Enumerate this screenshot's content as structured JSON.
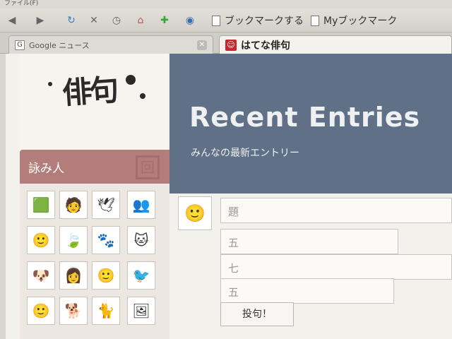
{
  "menubar": {
    "text": "ファイル(F)"
  },
  "toolbar": {
    "bookmark1": "ブックマークする",
    "bookmark2": "Myブックマーク"
  },
  "tabs": [
    {
      "label": "Google ニュース",
      "favicon": "G"
    },
    {
      "label": "はてな俳句",
      "favicon": "☺"
    }
  ],
  "logo": {
    "text": "俳句"
  },
  "sidebar": {
    "title": "詠み人",
    "avatars": [
      "🟩",
      "🧑",
      "🕊",
      "👥",
      "🙂",
      "🍃",
      "🐾",
      "🐱",
      "🐶",
      "👩",
      "🙂",
      "🐦",
      "🙂",
      "🐕",
      "🐈",
      "🖼"
    ]
  },
  "banner": {
    "title": "Recent Entries",
    "subtitle": "みんなの最新エントリー"
  },
  "form": {
    "title_placeholder": "題",
    "line1_placeholder": "五",
    "line2_placeholder": "七",
    "line3_placeholder": "五",
    "submit_label": "投句！",
    "avatar": "🙂"
  },
  "colors": {
    "banner": "#5f7087",
    "sidebar_head": "#b27d7a",
    "hatena_red": "#c8262b"
  }
}
